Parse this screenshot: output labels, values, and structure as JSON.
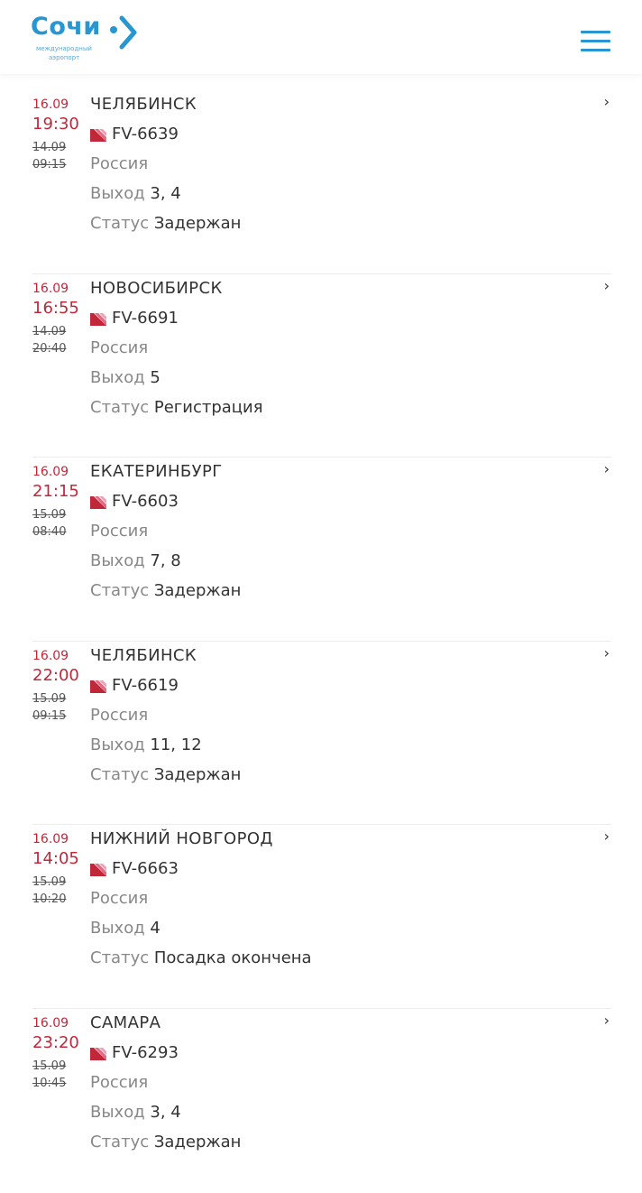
{
  "header": {
    "logo_word": "Сочи",
    "logo_sub_line1": "международный",
    "logo_sub_line2": "аэропорт"
  },
  "labels": {
    "gate": "Выход",
    "status": "Статус"
  },
  "colors": {
    "brand_blue": "#2796d1",
    "accent_red": "#c0283a"
  },
  "flights": [
    {
      "new_date": "16.09",
      "new_time": "19:30",
      "old_date": "14.09",
      "old_time": "09:15",
      "city": "ЧЕЛЯБИНСК",
      "flight_no": "FV-6639",
      "country": "Россия",
      "gate": "3, 4",
      "status": "Задержан"
    },
    {
      "new_date": "16.09",
      "new_time": "16:55",
      "old_date": "14.09",
      "old_time": "20:40",
      "city": "НОВОСИБИРСК",
      "flight_no": "FV-6691",
      "country": "Россия",
      "gate": "5",
      "status": "Регистрация"
    },
    {
      "new_date": "16.09",
      "new_time": "21:15",
      "old_date": "15.09",
      "old_time": "08:40",
      "city": "ЕКАТЕРИНБУРГ",
      "flight_no": "FV-6603",
      "country": "Россия",
      "gate": "7, 8",
      "status": "Задержан"
    },
    {
      "new_date": "16.09",
      "new_time": "22:00",
      "old_date": "15.09",
      "old_time": "09:15",
      "city": "ЧЕЛЯБИНСК",
      "flight_no": "FV-6619",
      "country": "Россия",
      "gate": "11, 12",
      "status": "Задержан"
    },
    {
      "new_date": "16.09",
      "new_time": "14:05",
      "old_date": "15.09",
      "old_time": "10:20",
      "city": "НИЖНИЙ НОВГОРОД",
      "flight_no": "FV-6663",
      "country": "Россия",
      "gate": "4",
      "status": "Посадка окончена"
    },
    {
      "new_date": "16.09",
      "new_time": "23:20",
      "old_date": "15.09",
      "old_time": "10:45",
      "city": "САМАРА",
      "flight_no": "FV-6293",
      "country": "Россия",
      "gate": "3, 4",
      "status": "Задержан"
    }
  ]
}
